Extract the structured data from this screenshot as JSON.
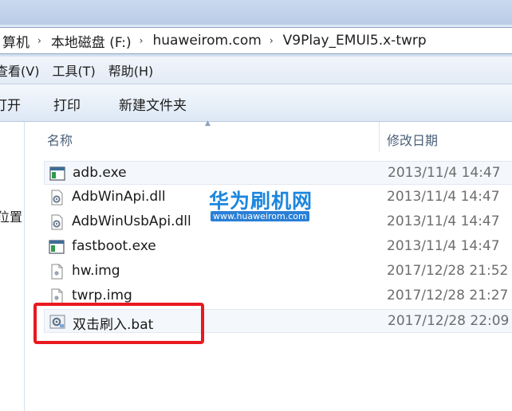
{
  "address": {
    "crumbs": [
      "算机",
      "本地磁盘 (F:)",
      "huaweirom.com",
      "V9Play_EMUI5.x-twrp"
    ],
    "separator": "›"
  },
  "menu": [
    "查看(V)",
    "工具(T)",
    "帮助(H)"
  ],
  "toolbar": {
    "open": "打开",
    "print": "打印",
    "new_folder": "新建文件夹"
  },
  "nav": {
    "partial_label": "位置"
  },
  "columns": {
    "name": "名称",
    "date_modified": "修改日期"
  },
  "files": [
    {
      "name": "adb.exe",
      "date": "2013/11/4 14:47",
      "icon": "exe-window-icon"
    },
    {
      "name": "AdbWinApi.dll",
      "date": "2013/11/4 14:47",
      "icon": "dll-gear-icon"
    },
    {
      "name": "AdbWinUsbApi.dll",
      "date": "2013/11/4 14:47",
      "icon": "dll-gear-icon"
    },
    {
      "name": "fastboot.exe",
      "date": "2013/11/4 14:47",
      "icon": "exe-window-icon"
    },
    {
      "name": "hw.img",
      "date": "2017/12/28 21:52",
      "icon": "img-file-icon"
    },
    {
      "name": "twrp.img",
      "date": "2017/12/28 21:27",
      "icon": "img-file-icon"
    },
    {
      "name": "双击刷入.bat",
      "date": "2017/12/28 22:09",
      "icon": "bat-gear-icon"
    }
  ],
  "watermark": {
    "brand": "华为刷机网",
    "url": "www.huaweirom.com"
  },
  "colors": {
    "highlight_box": "#e8191f",
    "watermark": "#1c86de"
  }
}
